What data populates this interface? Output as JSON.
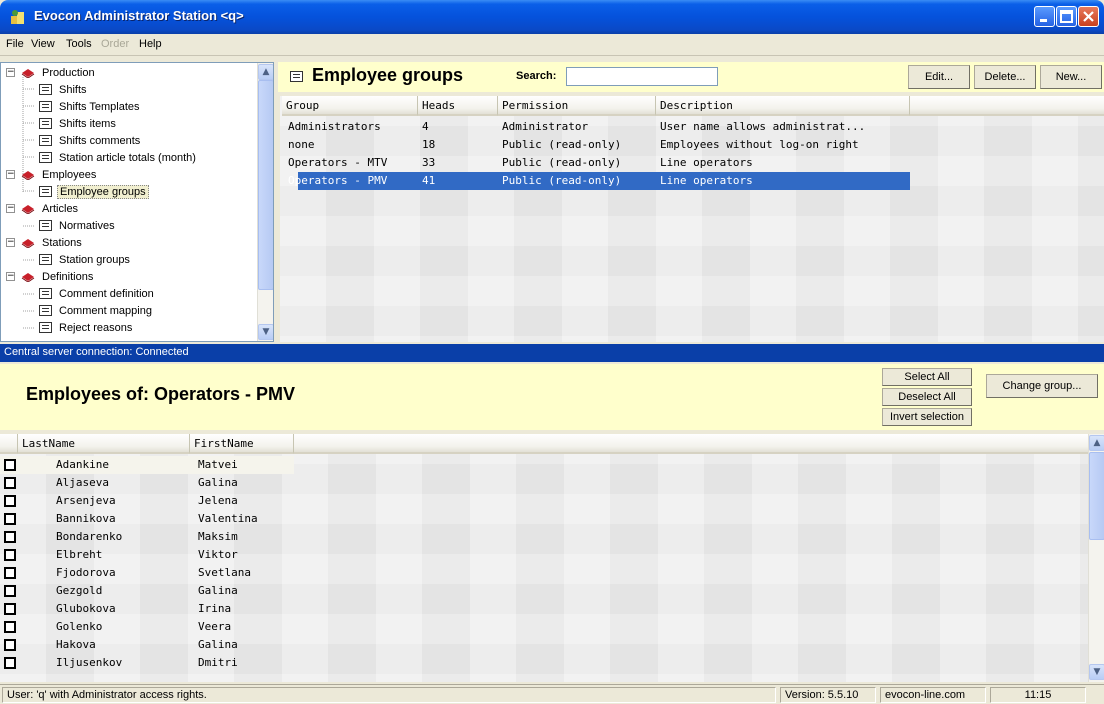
{
  "window": {
    "title": "Evocon Administrator Station  <q>"
  },
  "menu": [
    {
      "label": "File",
      "enabled": true
    },
    {
      "label": "View",
      "enabled": true
    },
    {
      "label": "Tools",
      "enabled": true
    },
    {
      "label": "Order",
      "enabled": false
    },
    {
      "label": "Help",
      "enabled": true
    }
  ],
  "tree": {
    "items": [
      {
        "label": "Production",
        "type": "folder",
        "level": 0
      },
      {
        "label": "Shifts",
        "type": "doc",
        "level": 1
      },
      {
        "label": "Shifts Templates",
        "type": "doc",
        "level": 1
      },
      {
        "label": "Shifts items",
        "type": "doc",
        "level": 1
      },
      {
        "label": "Shifts comments",
        "type": "doc",
        "level": 1
      },
      {
        "label": "Station article totals (month)",
        "type": "doc",
        "level": 1
      },
      {
        "label": "Employees",
        "type": "folder",
        "level": 0
      },
      {
        "label": "Employee groups",
        "type": "doc",
        "level": 1,
        "selected": true
      },
      {
        "label": "Articles",
        "type": "folder",
        "level": 0
      },
      {
        "label": "Normatives",
        "type": "doc",
        "level": 1
      },
      {
        "label": "Stations",
        "type": "folder",
        "level": 0
      },
      {
        "label": "Station groups",
        "type": "doc",
        "level": 1
      },
      {
        "label": "Definitions",
        "type": "folder",
        "level": 0
      },
      {
        "label": "Comment definition",
        "type": "doc",
        "level": 1
      },
      {
        "label": "Comment mapping",
        "type": "doc",
        "level": 1
      },
      {
        "label": "Reject reasons",
        "type": "doc",
        "level": 1
      }
    ]
  },
  "groups_panel": {
    "title": "Employee groups",
    "search_label": "Search:",
    "search_value": "",
    "buttons": {
      "edit": "Edit...",
      "delete": "Delete...",
      "new": "New..."
    },
    "columns": [
      "Group",
      "Heads",
      "Permission",
      "Description"
    ],
    "rows": [
      [
        "Administrators",
        "4",
        "Administrator",
        "User name allows administrat..."
      ],
      [
        "none",
        "18",
        "Public (read-only)",
        "Employees without log-on right"
      ],
      [
        "Operators - MTV",
        "33",
        "Public (read-only)",
        "Line operators"
      ],
      [
        "Operators - PMV",
        "41",
        "Public (read-only)",
        "Line operators"
      ]
    ],
    "selected_row": 3
  },
  "connection_status": "Central server connection: Connected",
  "employees_panel": {
    "title": "Employees of: Operators - PMV",
    "buttons": {
      "select_all": "Select All",
      "deselect_all": "Deselect All",
      "invert": "Invert selection",
      "change_group": "Change group..."
    },
    "columns": [
      "LastName",
      "FirstName"
    ],
    "rows": [
      [
        "Adankine",
        "Matvei"
      ],
      [
        "Aljaseva",
        "Galina"
      ],
      [
        "Arsenjeva",
        "Jelena"
      ],
      [
        "Bannikova",
        "Valentina"
      ],
      [
        "Bondarenko",
        "Maksim"
      ],
      [
        "Elbreht",
        "Viktor"
      ],
      [
        "Fjodorova",
        "Svetlana"
      ],
      [
        "Gezgold",
        "Galina"
      ],
      [
        "Glubokova",
        "Irina"
      ],
      [
        "Golenko",
        "Veera"
      ],
      [
        "Hakova",
        "Galina"
      ],
      [
        "Iljusenkov",
        "Dmitri"
      ]
    ]
  },
  "statusbar": {
    "user": "User: 'q' with Administrator access rights.",
    "version": "Version: 5.5.10",
    "site": "evocon-line.com",
    "time": "11:15"
  },
  "colors": {
    "title_blue": "#0552DC",
    "panel_yellow": "#FFFFCC",
    "selection": "#316AC5",
    "status_blue": "#0A3FA8"
  }
}
